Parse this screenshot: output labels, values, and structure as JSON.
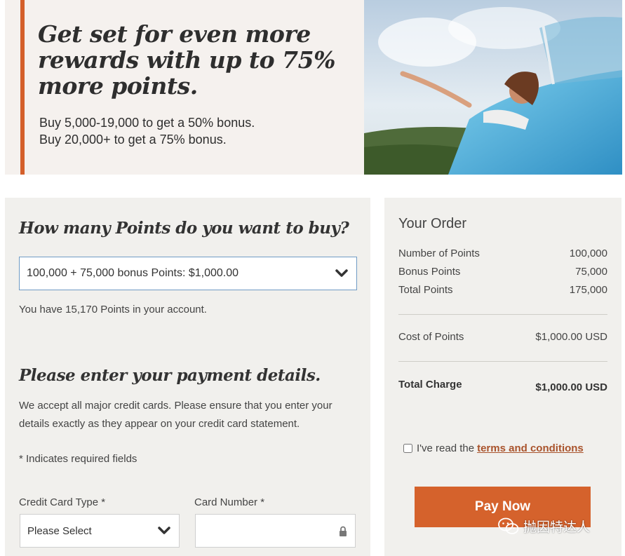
{
  "hero": {
    "title": "Get set for even more rewards with up to 75% more points.",
    "line1": "Buy 5,000-19,000 to get a 50% bonus.",
    "line2": "Buy 20,000+ to get a 75% bonus."
  },
  "points_section": {
    "heading": "How many Points do you want to buy?",
    "selected_option": "100,000 + 75,000 bonus Points: $1,000.00",
    "balance_text": "You have 15,170 Points in your account."
  },
  "payment_section": {
    "heading": "Please enter your payment details.",
    "description": "We accept all major credit cards. Please ensure that you enter your details exactly as they appear on your credit card statement.",
    "required_note": "* Indicates required fields",
    "card_type_label": "Credit Card Type *",
    "card_type_value": "Please Select",
    "card_number_label": "Card Number *",
    "card_number_value": ""
  },
  "order": {
    "title": "Your Order",
    "rows": [
      {
        "label": "Number of Points",
        "value": "100,000"
      },
      {
        "label": "Bonus Points",
        "value": "75,000"
      },
      {
        "label": "Total Points",
        "value": "175,000"
      },
      {
        "label": "Cost of Points",
        "value": "$1,000.00 USD"
      }
    ],
    "total_label": "Total Charge",
    "total_value": "$1,000.00 USD",
    "terms_prefix": "I've read the",
    "terms_link": "terms and conditions",
    "pay_button": "Pay Now"
  },
  "watermark": {
    "text": "抛因特达人"
  },
  "colors": {
    "accent": "#d5622c",
    "link": "#a9532c",
    "panel": "#f1f0ed",
    "hero_bg": "#f5f1ee"
  },
  "icons": {
    "select_arrow": "chevron-down-icon",
    "lock": "lock-icon",
    "watermark": "wechat-icon"
  }
}
